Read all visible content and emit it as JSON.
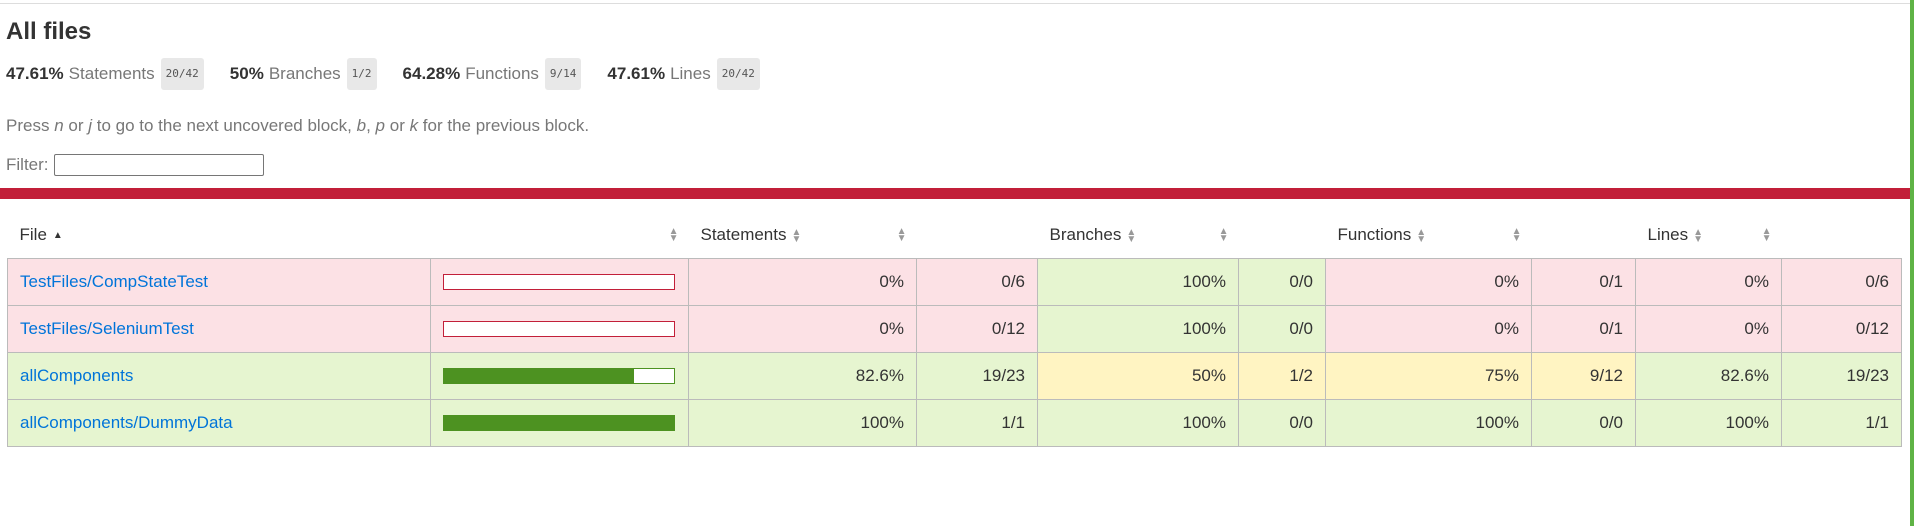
{
  "page": {
    "title": "All files"
  },
  "summary": [
    {
      "pct": "47.61%",
      "label": "Statements",
      "frac": "20/42"
    },
    {
      "pct": "50%",
      "label": "Branches",
      "frac": "1/2"
    },
    {
      "pct": "64.28%",
      "label": "Functions",
      "frac": "9/14"
    },
    {
      "pct": "47.61%",
      "label": "Lines",
      "frac": "20/42"
    }
  ],
  "hint": {
    "press": "Press ",
    "k1": "n",
    "or1": " or ",
    "k2": "j",
    "mid": " to go to the next uncovered block, ",
    "k3": "b",
    "comma": ", ",
    "k4": "p",
    "or2": " or ",
    "k5": "k",
    "end": " for the previous block."
  },
  "filter": {
    "label": "Filter:",
    "value": ""
  },
  "colors": {
    "low": "#fce1e5",
    "medium": "#fff4c2",
    "high": "#e6f5d0",
    "status_bar": "#c21f39",
    "bar_fill": "#4d9221",
    "link": "#0074d9"
  },
  "table": {
    "headers": {
      "file": "File",
      "statements": "Statements",
      "branches": "Branches",
      "functions": "Functions",
      "lines": "Lines"
    },
    "rows": [
      {
        "file": "TestFiles/CompStateTest",
        "coverage": 0,
        "statements_pct": "0%",
        "statements_frac": "0/6",
        "statements_level": "low",
        "branches_pct": "100%",
        "branches_frac": "0/0",
        "branches_level": "high",
        "functions_pct": "0%",
        "functions_frac": "0/1",
        "functions_level": "low",
        "lines_pct": "0%",
        "lines_frac": "0/6",
        "lines_level": "low"
      },
      {
        "file": "TestFiles/SeleniumTest",
        "coverage": 0,
        "statements_pct": "0%",
        "statements_frac": "0/12",
        "statements_level": "low",
        "branches_pct": "100%",
        "branches_frac": "0/0",
        "branches_level": "high",
        "functions_pct": "0%",
        "functions_frac": "0/1",
        "functions_level": "low",
        "lines_pct": "0%",
        "lines_frac": "0/12",
        "lines_level": "low"
      },
      {
        "file": "allComponents",
        "coverage": 82.6,
        "statements_pct": "82.6%",
        "statements_frac": "19/23",
        "statements_level": "high",
        "branches_pct": "50%",
        "branches_frac": "1/2",
        "branches_level": "medium",
        "functions_pct": "75%",
        "functions_frac": "9/12",
        "functions_level": "medium",
        "lines_pct": "82.6%",
        "lines_frac": "19/23",
        "lines_level": "high"
      },
      {
        "file": "allComponents/DummyData",
        "coverage": 100,
        "statements_pct": "100%",
        "statements_frac": "1/1",
        "statements_level": "high",
        "branches_pct": "100%",
        "branches_frac": "0/0",
        "branches_level": "high",
        "functions_pct": "100%",
        "functions_frac": "0/0",
        "functions_level": "high",
        "lines_pct": "100%",
        "lines_frac": "1/1",
        "lines_level": "high"
      }
    ]
  }
}
